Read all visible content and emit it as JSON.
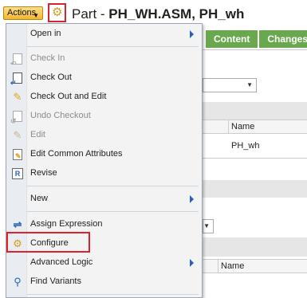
{
  "header": {
    "actions_label": "Actions",
    "title_prefix": "Part - ",
    "title_bold": "PH_WH.ASM, PH",
    "title_suffix": "_wh"
  },
  "background": {
    "tabs": [
      "Content",
      "Changes"
    ],
    "col_header_1": "Name",
    "cell_1": "PH_wh",
    "col_header_2": "Name"
  },
  "menu": {
    "items": [
      {
        "label": "Open in",
        "submenu": true,
        "disabled": false,
        "icon": "none"
      },
      {
        "label": "Check In",
        "submenu": false,
        "disabled": true,
        "icon": "check-in-icon"
      },
      {
        "label": "Check Out",
        "submenu": false,
        "disabled": false,
        "icon": "check-out-icon"
      },
      {
        "label": "Check Out and Edit",
        "submenu": false,
        "disabled": false,
        "icon": "pencil-icon"
      },
      {
        "label": "Undo Checkout",
        "submenu": false,
        "disabled": true,
        "icon": "undo-checkout-icon"
      },
      {
        "label": "Edit",
        "submenu": false,
        "disabled": true,
        "icon": "pencil-icon"
      },
      {
        "label": "Edit Common Attributes",
        "submenu": false,
        "disabled": false,
        "icon": "edit-attributes-icon"
      },
      {
        "label": "Revise",
        "submenu": false,
        "disabled": false,
        "icon": "revise-icon"
      },
      {
        "label": "New",
        "submenu": true,
        "disabled": false,
        "icon": "none"
      },
      {
        "label": "Assign Expression",
        "submenu": false,
        "disabled": false,
        "icon": "assign-expression-icon"
      },
      {
        "label": "Configure",
        "submenu": false,
        "disabled": false,
        "icon": "configure-icon"
      },
      {
        "label": "Advanced Logic",
        "submenu": true,
        "disabled": false,
        "icon": "none"
      },
      {
        "label": "Find Variants",
        "submenu": false,
        "disabled": false,
        "icon": "search-icon"
      }
    ]
  },
  "colors": {
    "highlight": "#d9232e",
    "tab_green": "#6aa84f",
    "actions_gold": "#f2b631"
  }
}
